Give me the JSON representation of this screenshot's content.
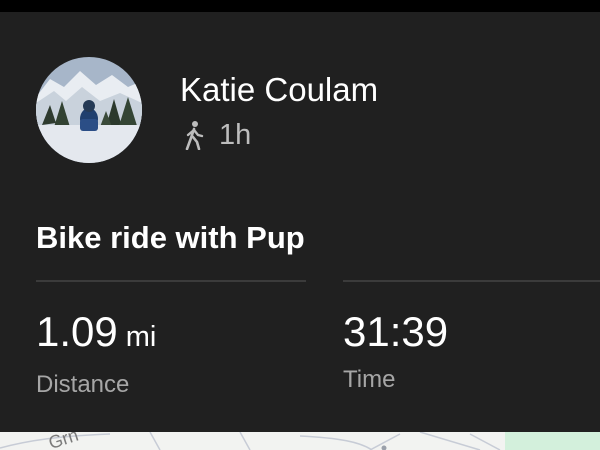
{
  "activity_card": {
    "user_name": "Katie Coulam",
    "activity_type_icon": "walking-person-icon",
    "elapsed": "1h",
    "title": "Bike ride with Pup",
    "stats": {
      "distance": {
        "value": "1.09",
        "unit": "mi",
        "label": "Distance"
      },
      "time": {
        "value": "31:39",
        "label": "Time"
      }
    }
  },
  "map_preview": {
    "street_label": "Grn"
  },
  "colors": {
    "background": "#202020",
    "status_bar": "#000000",
    "primary_text": "#ffffff",
    "secondary_text": "#a6a6a6",
    "divider": "#3b3b3b",
    "map_background": "#f2f3f1",
    "map_park": "#d3f0dc"
  }
}
